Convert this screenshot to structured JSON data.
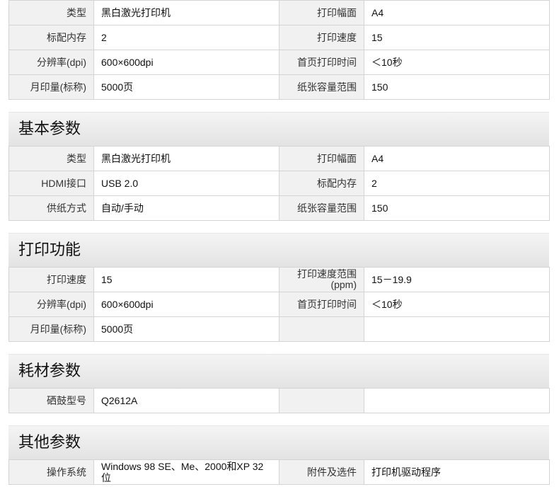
{
  "top_table": [
    [
      "类型",
      "黑白激光打印机",
      "打印幅面",
      "A4"
    ],
    [
      "标配内存",
      "2",
      "打印速度",
      "15"
    ],
    [
      "分辨率(dpi)",
      "600×600dpi",
      "首页打印时间",
      "＜10秒"
    ],
    [
      "月印量(标称)",
      "5000页",
      "纸张容量范围",
      "150"
    ]
  ],
  "sections": [
    {
      "title": "基本参数",
      "rows": [
        [
          "类型",
          "黑白激光打印机",
          "打印幅面",
          "A4"
        ],
        [
          "HDMI接口",
          "USB 2.0",
          "标配内存",
          "2"
        ],
        [
          "供纸方式",
          "自动/手动",
          "纸张容量范围",
          "150"
        ]
      ]
    },
    {
      "title": "打印功能",
      "rows": [
        [
          "打印速度",
          "15",
          "打印速度范围(ppm)",
          "15－19.9"
        ],
        [
          "分辨率(dpi)",
          "600×600dpi",
          "首页打印时间",
          "＜10秒"
        ],
        [
          "月印量(标称)",
          "5000页",
          "",
          ""
        ]
      ]
    },
    {
      "title": "耗材参数",
      "rows": [
        [
          "硒鼓型号",
          "Q2612A",
          "",
          ""
        ]
      ]
    },
    {
      "title": "其他参数",
      "rows": [
        [
          "操作系统",
          "Windows 98 SE、Me、2000和XP 32位",
          "附件及选件",
          "打印机驱动程序"
        ]
      ]
    }
  ]
}
